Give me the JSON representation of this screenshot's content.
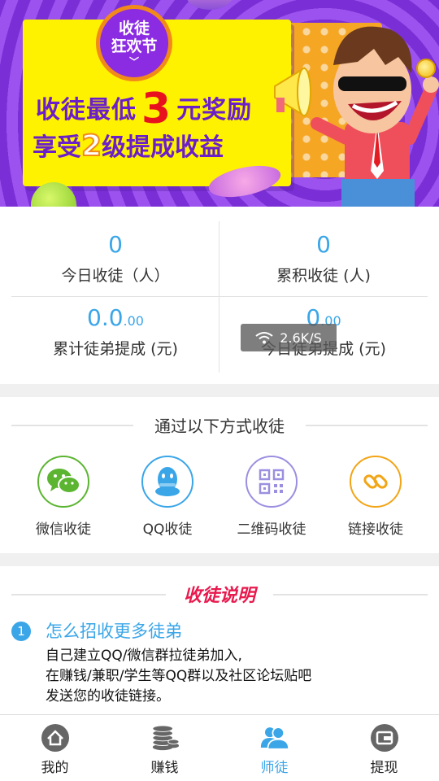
{
  "banner": {
    "badge_line1": "收徒",
    "badge_line2": "狂欢节",
    "headline_pre": "收徒最低",
    "headline_num": "3",
    "headline_post": "元奖励",
    "sub_pre": "享受",
    "sub_num": "2",
    "sub_post": "级提成收益"
  },
  "stats": [
    {
      "value": "0",
      "decimals": "",
      "label": "今日收徒（人）"
    },
    {
      "value": "0",
      "decimals": "",
      "label": "累积收徒 (人)"
    },
    {
      "value": "0.0",
      "decimals": ".00",
      "label": "累计徒弟提成 (元)"
    },
    {
      "value": "0",
      "decimals": ".00",
      "label": "今日徒弟提成 (元)"
    }
  ],
  "toast": {
    "text": "2.6K/S",
    "icon": "wifi-icon"
  },
  "methods": {
    "title": "通过以下方式收徒",
    "items": [
      {
        "label": "微信收徒",
        "icon": "wechat-icon",
        "color": "#5cb531"
      },
      {
        "label": "QQ收徒",
        "icon": "qq-icon",
        "color": "#3aa6e8"
      },
      {
        "label": "二维码收徒",
        "icon": "qrcode-icon",
        "color": "#9b8fe0"
      },
      {
        "label": "链接收徒",
        "icon": "link-icon",
        "color": "#f2a516"
      }
    ]
  },
  "description": {
    "title": "收徒说明",
    "step_number": "1",
    "step_title": "怎么招收更多徒弟",
    "lines": [
      "自己建立QQ/微信群拉徒弟加入,",
      "在赚钱/兼职/学生等QQ群以及社区论坛贴吧",
      "发送您的收徒链接。"
    ]
  },
  "tabs": [
    {
      "label": "我的",
      "icon": "home-icon",
      "active": false
    },
    {
      "label": "赚钱",
      "icon": "coins-icon",
      "active": false
    },
    {
      "label": "师徒",
      "icon": "people-icon",
      "active": true
    },
    {
      "label": "提现",
      "icon": "wallet-icon",
      "active": false
    }
  ],
  "colors": {
    "accent": "#3aa6e8",
    "title_red": "#e8194d",
    "banner_purple": "#8b2be2",
    "banner_yellow": "#fff200"
  }
}
